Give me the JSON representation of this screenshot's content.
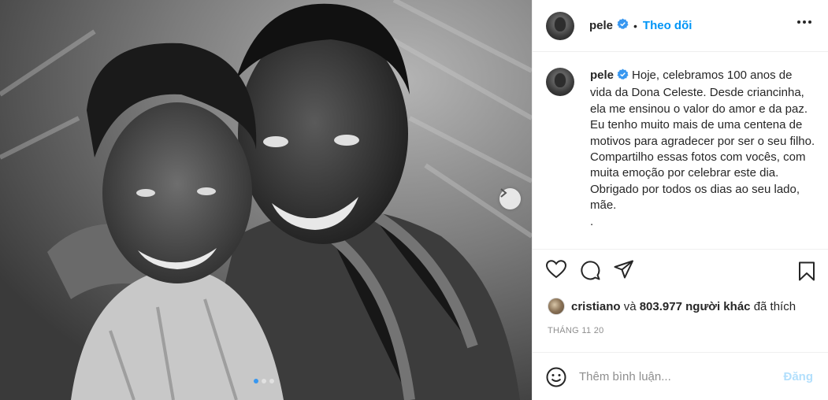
{
  "post": {
    "image_alt": "black-and-white photo of an elderly woman and a smiling man embracing",
    "carousel": {
      "count": 3,
      "active_index": 0
    }
  },
  "header": {
    "username": "pele",
    "separator": "•",
    "follow_label": "Theo dõi",
    "verified_icon": "verified-badge-icon",
    "more_icon": "more-options-icon"
  },
  "caption": {
    "username": "pele",
    "text": "Hoje, celebramos 100 anos de vida da Dona Celeste. Desde criancinha, ela me ensinou o valor do amor e da paz. Eu tenho muito mais de uma centena de motivos para agradecer por ser o seu filho. Compartilho essas fotos com vocês, com muita emoção por celebrar este dia. Obrigado por todos os dias ao seu lado, mãe.",
    "trailing": "."
  },
  "actions": {
    "like_icon": "heart-icon",
    "comment_icon": "comment-icon",
    "share_icon": "share-icon",
    "save_icon": "bookmark-icon"
  },
  "likes": {
    "user": "cristiano",
    "connector": "và",
    "count": "803.977",
    "others": "người khác",
    "suffix": "đã thích"
  },
  "date": "THÁNG 11 20",
  "comment": {
    "placeholder": "Thêm bình luận...",
    "post_label": "Đăng",
    "emoji_icon": "emoji-icon"
  },
  "colors": {
    "link": "#0095f6",
    "verified": "#3897f0",
    "post_disabled": "#b2dffc",
    "muted": "#8e8e8e"
  }
}
